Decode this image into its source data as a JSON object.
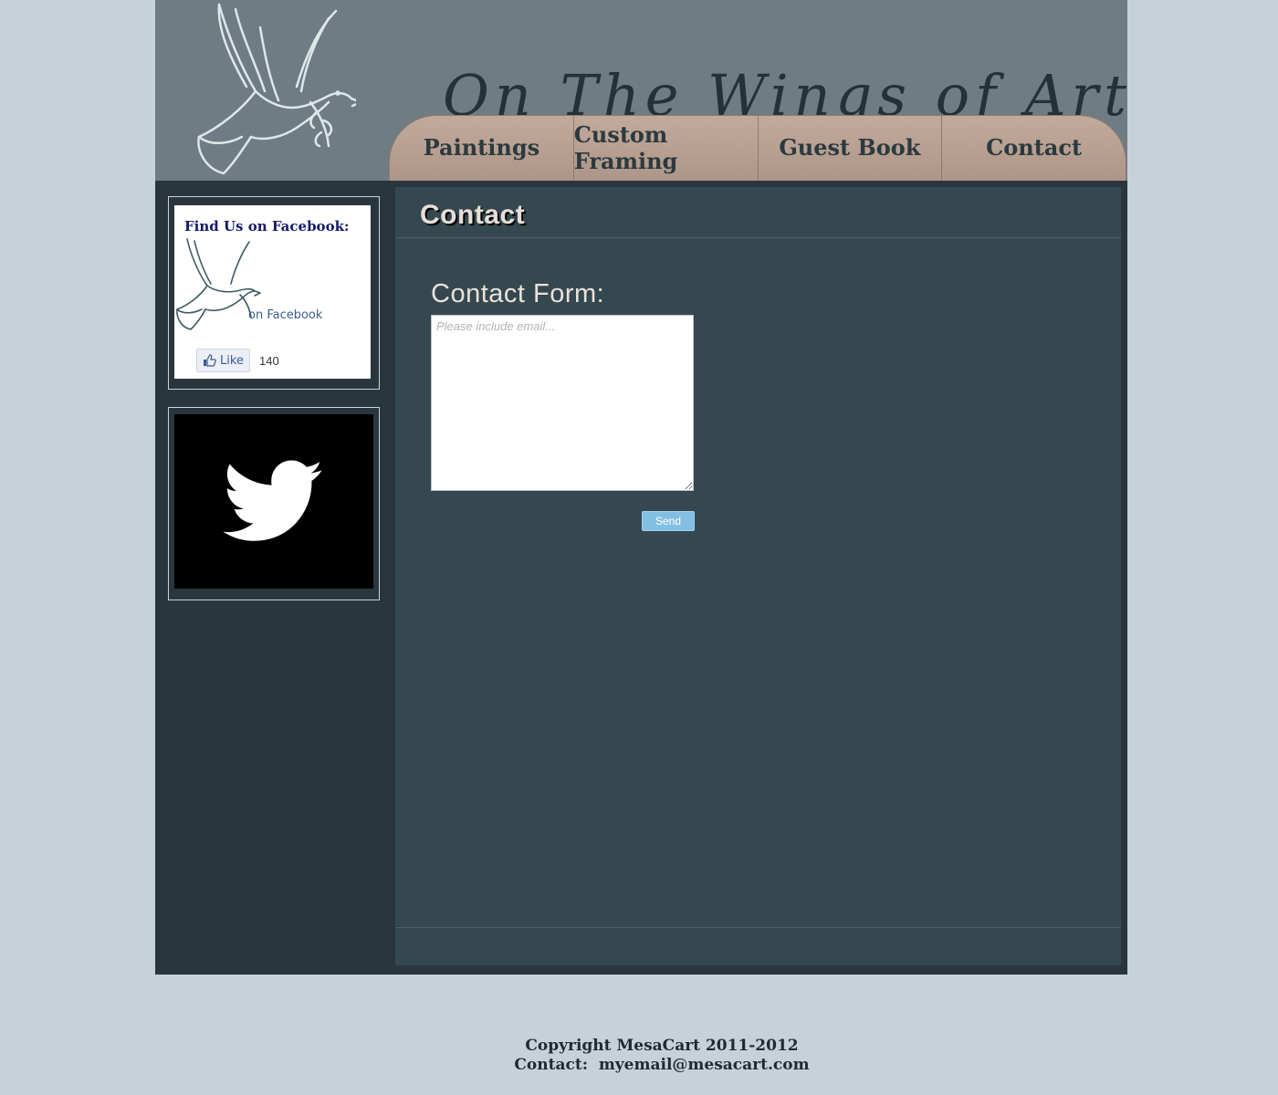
{
  "header": {
    "site_title": "On The Wings of Art",
    "logo_icon": "dove-icon",
    "background_color": "#6f7c83"
  },
  "nav": {
    "items": [
      {
        "label": "Paintings"
      },
      {
        "label": "Custom Framing"
      },
      {
        "label": "Guest Book"
      },
      {
        "label": "Contact"
      }
    ]
  },
  "sidebar": {
    "facebook": {
      "title": "Find Us on Facebook:",
      "subtitle": "on Facebook",
      "like_label": "Like",
      "like_count": "140",
      "icon": "dove-icon"
    },
    "twitter": {
      "icon": "twitter-bird-icon"
    }
  },
  "main": {
    "page_heading": "Contact",
    "form_title": "Contact Form:",
    "message_placeholder": "Please include email...",
    "send_label": "Send"
  },
  "footer": {
    "copyright": "Copyright MesaCart 2011-2012",
    "contact_line": "Contact:  myemail@mesacart.com"
  },
  "colors": {
    "page_bg": "#c6d2d7",
    "content_bg": "#354850",
    "sidebar_bg": "#2a363d",
    "nav_bg": "#bfa698",
    "send_button": "#83bfe3"
  }
}
